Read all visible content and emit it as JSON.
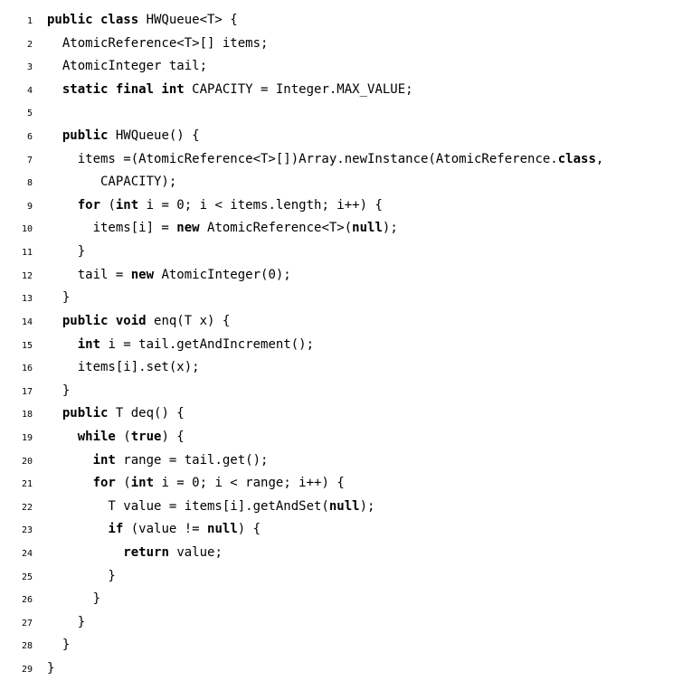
{
  "lines": [
    {
      "n": 1,
      "segs": [
        {
          "t": "public class ",
          "b": true
        },
        {
          "t": "HWQueue<T> {",
          "b": false
        }
      ]
    },
    {
      "n": 2,
      "segs": [
        {
          "t": "  AtomicReference<T>[] items;",
          "b": false
        }
      ]
    },
    {
      "n": 3,
      "segs": [
        {
          "t": "  AtomicInteger tail;",
          "b": false
        }
      ]
    },
    {
      "n": 4,
      "segs": [
        {
          "t": "  ",
          "b": false
        },
        {
          "t": "static final int ",
          "b": true
        },
        {
          "t": "CAPACITY = Integer.MAX_VALUE;",
          "b": false
        }
      ]
    },
    {
      "n": 5,
      "segs": [
        {
          "t": " ",
          "b": false
        }
      ]
    },
    {
      "n": 6,
      "segs": [
        {
          "t": "  ",
          "b": false
        },
        {
          "t": "public ",
          "b": true
        },
        {
          "t": "HWQueue() {",
          "b": false
        }
      ]
    },
    {
      "n": 7,
      "segs": [
        {
          "t": "    items =(AtomicReference<T>[])Array.newInstance(AtomicReference.",
          "b": false
        },
        {
          "t": "class",
          "b": true
        },
        {
          "t": ",",
          "b": false
        }
      ]
    },
    {
      "n": 8,
      "segs": [
        {
          "t": "       CAPACITY);",
          "b": false
        }
      ]
    },
    {
      "n": 9,
      "segs": [
        {
          "t": "    ",
          "b": false
        },
        {
          "t": "for ",
          "b": true
        },
        {
          "t": "(",
          "b": false
        },
        {
          "t": "int ",
          "b": true
        },
        {
          "t": "i = 0; i < items.length; i++) {",
          "b": false
        }
      ]
    },
    {
      "n": 10,
      "segs": [
        {
          "t": "      items[i] = ",
          "b": false
        },
        {
          "t": "new ",
          "b": true
        },
        {
          "t": "AtomicReference<T>(",
          "b": false
        },
        {
          "t": "null",
          "b": true
        },
        {
          "t": ");",
          "b": false
        }
      ]
    },
    {
      "n": 11,
      "segs": [
        {
          "t": "    }",
          "b": false
        }
      ]
    },
    {
      "n": 12,
      "segs": [
        {
          "t": "    tail = ",
          "b": false
        },
        {
          "t": "new ",
          "b": true
        },
        {
          "t": "AtomicInteger(0);",
          "b": false
        }
      ]
    },
    {
      "n": 13,
      "segs": [
        {
          "t": "  }",
          "b": false
        }
      ]
    },
    {
      "n": 14,
      "segs": [
        {
          "t": "  ",
          "b": false
        },
        {
          "t": "public void ",
          "b": true
        },
        {
          "t": "enq(T x) {",
          "b": false
        }
      ]
    },
    {
      "n": 15,
      "segs": [
        {
          "t": "    ",
          "b": false
        },
        {
          "t": "int ",
          "b": true
        },
        {
          "t": "i = tail.getAndIncrement();",
          "b": false
        }
      ]
    },
    {
      "n": 16,
      "segs": [
        {
          "t": "    items[i].set(x);",
          "b": false
        }
      ]
    },
    {
      "n": 17,
      "segs": [
        {
          "t": "  }",
          "b": false
        }
      ]
    },
    {
      "n": 18,
      "segs": [
        {
          "t": "  ",
          "b": false
        },
        {
          "t": "public ",
          "b": true
        },
        {
          "t": "T deq() {",
          "b": false
        }
      ]
    },
    {
      "n": 19,
      "segs": [
        {
          "t": "    ",
          "b": false
        },
        {
          "t": "while ",
          "b": true
        },
        {
          "t": "(",
          "b": false
        },
        {
          "t": "true",
          "b": true
        },
        {
          "t": ") {",
          "b": false
        }
      ]
    },
    {
      "n": 20,
      "segs": [
        {
          "t": "      ",
          "b": false
        },
        {
          "t": "int ",
          "b": true
        },
        {
          "t": "range = tail.get();",
          "b": false
        }
      ]
    },
    {
      "n": 21,
      "segs": [
        {
          "t": "      ",
          "b": false
        },
        {
          "t": "for ",
          "b": true
        },
        {
          "t": "(",
          "b": false
        },
        {
          "t": "int ",
          "b": true
        },
        {
          "t": "i = 0; i < range; i++) {",
          "b": false
        }
      ]
    },
    {
      "n": 22,
      "segs": [
        {
          "t": "        T value = items[i].getAndSet(",
          "b": false
        },
        {
          "t": "null",
          "b": true
        },
        {
          "t": ");",
          "b": false
        }
      ]
    },
    {
      "n": 23,
      "segs": [
        {
          "t": "        ",
          "b": false
        },
        {
          "t": "if ",
          "b": true
        },
        {
          "t": "(value != ",
          "b": false
        },
        {
          "t": "null",
          "b": true
        },
        {
          "t": ") {",
          "b": false
        }
      ]
    },
    {
      "n": 24,
      "segs": [
        {
          "t": "          ",
          "b": false
        },
        {
          "t": "return ",
          "b": true
        },
        {
          "t": "value;",
          "b": false
        }
      ]
    },
    {
      "n": 25,
      "segs": [
        {
          "t": "        }",
          "b": false
        }
      ]
    },
    {
      "n": 26,
      "segs": [
        {
          "t": "      }",
          "b": false
        }
      ]
    },
    {
      "n": 27,
      "segs": [
        {
          "t": "    }",
          "b": false
        }
      ]
    },
    {
      "n": 28,
      "segs": [
        {
          "t": "  }",
          "b": false
        }
      ]
    },
    {
      "n": 29,
      "segs": [
        {
          "t": "}",
          "b": false
        }
      ]
    }
  ]
}
